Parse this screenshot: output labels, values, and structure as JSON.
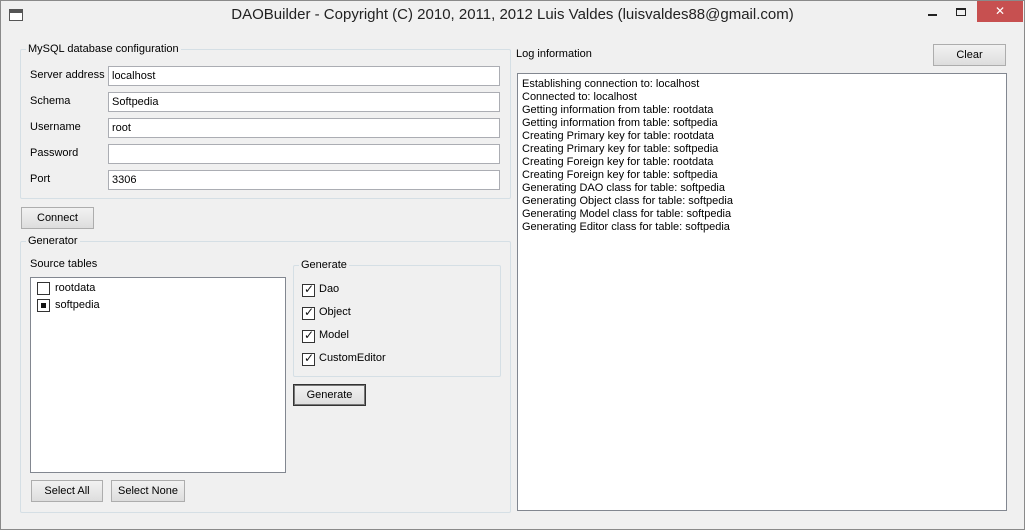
{
  "window": {
    "title": "DAOBuilder - Copyright (C) 2010, 2011, 2012  Luis Valdes (luisvaldes88@gmail.com)",
    "close_glyph": "✕"
  },
  "db_config": {
    "group_title": "MySQL database configuration",
    "fields": [
      {
        "label": "Server address",
        "value": "localhost"
      },
      {
        "label": "Schema",
        "value": "Softpedia"
      },
      {
        "label": "Username",
        "value": "root"
      },
      {
        "label": "Password",
        "value": ""
      },
      {
        "label": "Port",
        "value": "3306"
      }
    ],
    "connect_label": "Connect"
  },
  "generator": {
    "group_title": "Generator",
    "source_tables_label": "Source tables",
    "tables": [
      {
        "name": "rootdata",
        "state": "unchecked"
      },
      {
        "name": "softpedia",
        "state": "partial"
      }
    ],
    "select_all_label": "Select All",
    "select_none_label": "Select None",
    "generate_group_title": "Generate",
    "options": [
      {
        "label": "Dao",
        "checked": true
      },
      {
        "label": "Object",
        "checked": true
      },
      {
        "label": "Model",
        "checked": true
      },
      {
        "label": "CustomEditor",
        "checked": true
      }
    ],
    "generate_label": "Generate"
  },
  "log": {
    "title": "Log information",
    "clear_label": "Clear",
    "lines": [
      "Establishing connection to: localhost",
      "Connected to: localhost",
      "Getting information from table: rootdata",
      "Getting information from table: softpedia",
      "Creating Primary key for table: rootdata",
      "Creating Primary key for table: softpedia",
      "Creating Foreign key for table: rootdata",
      "Creating Foreign key for table: softpedia",
      "Generating DAO class for table: softpedia",
      "Generating Object class for table: softpedia",
      "Generating Model class for table: softpedia",
      "Generating Editor class for table: softpedia"
    ]
  }
}
